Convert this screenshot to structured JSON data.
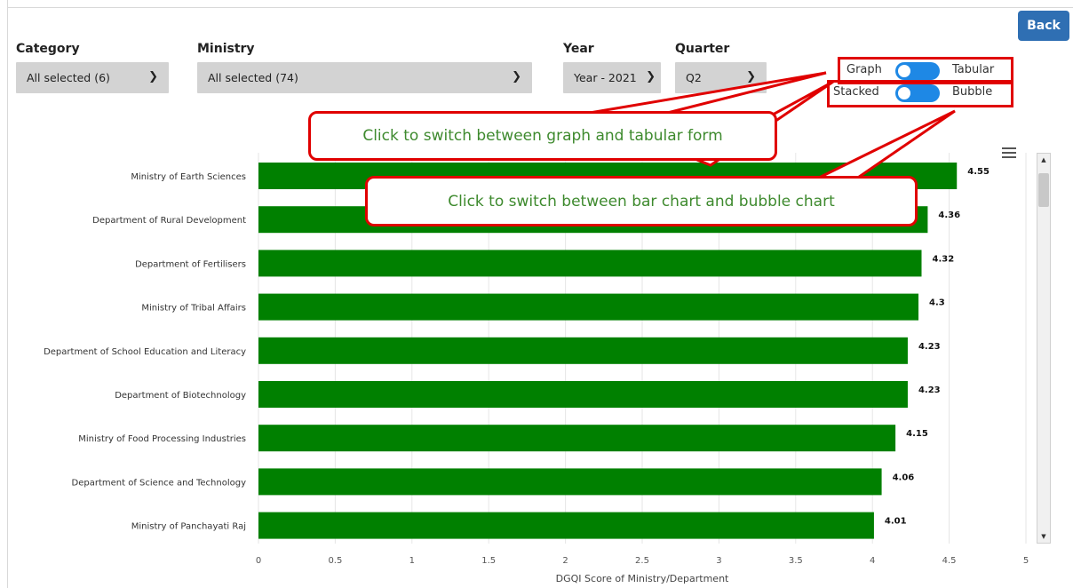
{
  "toolbar": {
    "back_label": "Back"
  },
  "filters": {
    "category": {
      "label": "Category",
      "value": "All selected (6)"
    },
    "ministry": {
      "label": "Ministry",
      "value": "All selected (74)"
    },
    "year": {
      "label": "Year",
      "value": "Year - 2021"
    },
    "quarter": {
      "label": "Quarter",
      "value": "Q2"
    }
  },
  "toggles": {
    "view": {
      "left_label": "Graph",
      "right_label": "Tabular"
    },
    "chart_type": {
      "left_label": "Stacked",
      "right_label": "Bubble"
    }
  },
  "callouts": {
    "view_hint": "Click to switch between graph and tabular form",
    "chart_hint": "Click to switch between bar chart and bubble chart"
  },
  "colors": {
    "bar": "#008000",
    "accent": "#1e88e5",
    "highlight": "#e00000",
    "hint_text": "#3e8a2e"
  },
  "chart_data": {
    "type": "bar",
    "orientation": "horizontal",
    "categories": [
      "Ministry of Earth Sciences",
      "Department of Rural Development",
      "Department of Fertilisers",
      "Ministry of Tribal Affairs",
      "Department of School Education and Literacy",
      "Department of Biotechnology",
      "Ministry of Food Processing Industries",
      "Department of Science and Technology",
      "Ministry of Panchayati Raj"
    ],
    "values": [
      4.55,
      4.36,
      4.32,
      4.3,
      4.23,
      4.23,
      4.15,
      4.06,
      4.01
    ],
    "data_labels": [
      "4.55",
      "4.36",
      "4.32",
      "4.3",
      "4.23",
      "4.23",
      "4.15",
      "4.06",
      "4.01"
    ],
    "xlabel": "DGQI Score of Ministry/Department",
    "xlim": [
      0,
      5
    ],
    "xticks": [
      "0",
      "0.5",
      "1",
      "1.5",
      "2",
      "2.5",
      "3",
      "3.5",
      "4",
      "4.5",
      "5"
    ],
    "grid": true
  }
}
